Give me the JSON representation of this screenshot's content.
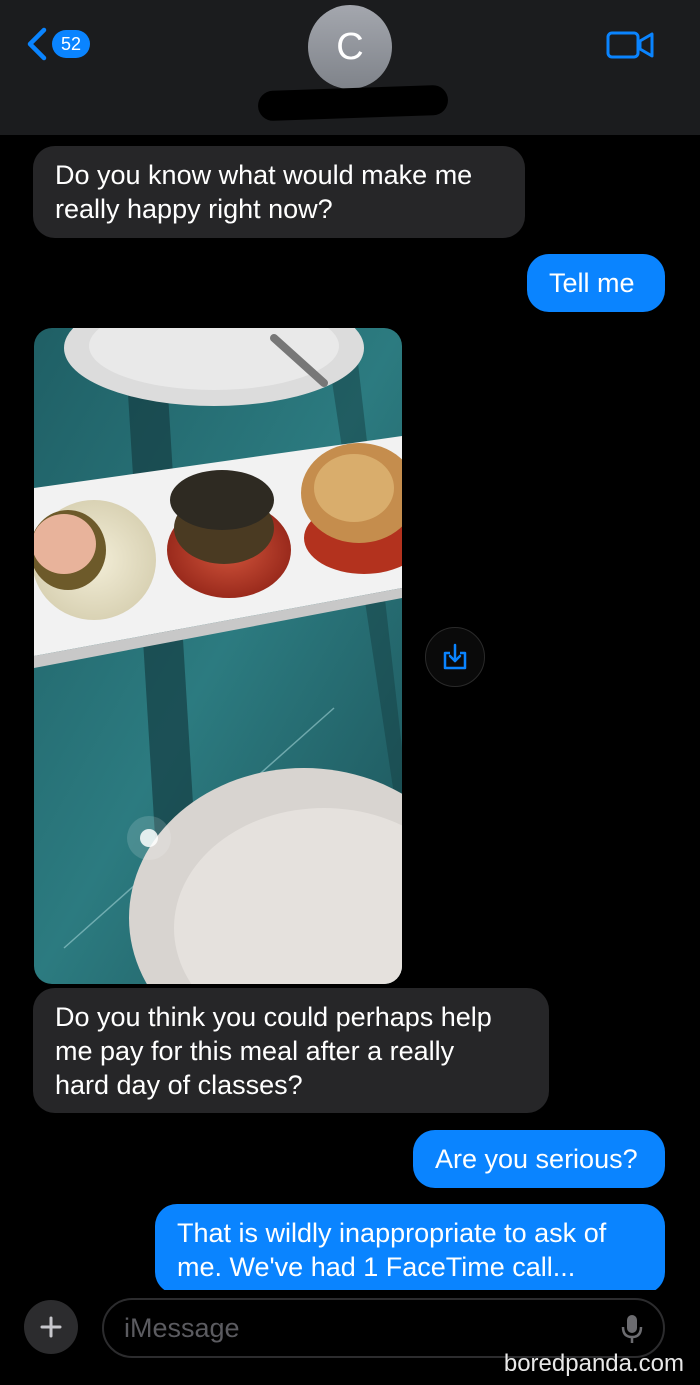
{
  "header": {
    "unread_count": "52",
    "contact_initial": "C"
  },
  "messages": [
    {
      "direction": "incoming",
      "text": "Do you know what would make me\nreally happy right now?"
    },
    {
      "direction": "outgoing",
      "text": "Tell me"
    },
    {
      "direction": "incoming",
      "type": "photo"
    },
    {
      "direction": "incoming",
      "text": "Do you think you could perhaps help\nme pay for this meal after a really\nhard day of classes?"
    },
    {
      "direction": "outgoing",
      "text": "Are you serious?"
    },
    {
      "direction": "outgoing",
      "text": "That is wildly inappropriate to ask of\nme. We've had 1 FaceTime call..."
    }
  ],
  "composer": {
    "placeholder": "iMessage"
  },
  "watermark": "boredpanda.com",
  "colors": {
    "accent": "#0a84ff",
    "incoming_bubble": "#262628",
    "background": "#000000",
    "header_bg": "#1b1c1e"
  },
  "icons": [
    "back-chevron-icon",
    "video-camera-icon",
    "download-icon",
    "plus-icon",
    "mic-icon"
  ]
}
